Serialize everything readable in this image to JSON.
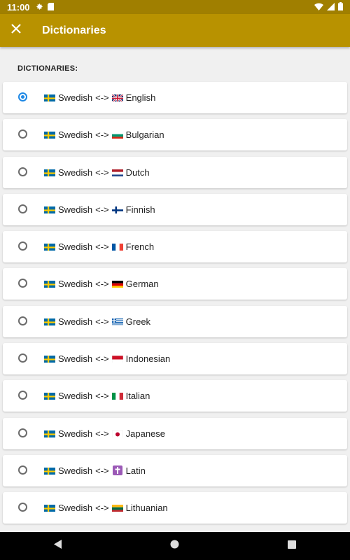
{
  "status_bar": {
    "time": "11:00"
  },
  "app_bar": {
    "title": "Dictionaries"
  },
  "section": {
    "header": "DICTIONARIES:"
  },
  "dictionaries": [
    {
      "source": "Swedish",
      "separator": "<->",
      "target": "English",
      "selected": true
    },
    {
      "source": "Swedish",
      "separator": "<->",
      "target": "Bulgarian",
      "selected": false
    },
    {
      "source": "Swedish",
      "separator": "<->",
      "target": "Dutch",
      "selected": false
    },
    {
      "source": "Swedish",
      "separator": "<->",
      "target": "Finnish",
      "selected": false
    },
    {
      "source": "Swedish",
      "separator": "<->",
      "target": "French",
      "selected": false
    },
    {
      "source": "Swedish",
      "separator": "<->",
      "target": "German",
      "selected": false
    },
    {
      "source": "Swedish",
      "separator": "<->",
      "target": "Greek",
      "selected": false
    },
    {
      "source": "Swedish",
      "separator": "<->",
      "target": "Indonesian",
      "selected": false
    },
    {
      "source": "Swedish",
      "separator": "<->",
      "target": "Italian",
      "selected": false
    },
    {
      "source": "Swedish",
      "separator": "<->",
      "target": "Japanese",
      "selected": false
    },
    {
      "source": "Swedish",
      "separator": "<->",
      "target": "Latin",
      "selected": false
    },
    {
      "source": "Swedish",
      "separator": "<->",
      "target": "Lithuanian",
      "selected": false
    }
  ],
  "colors": {
    "app_bar": "#b89200",
    "status_bar": "#a07f00",
    "radio_selected": "#1e88e5"
  }
}
